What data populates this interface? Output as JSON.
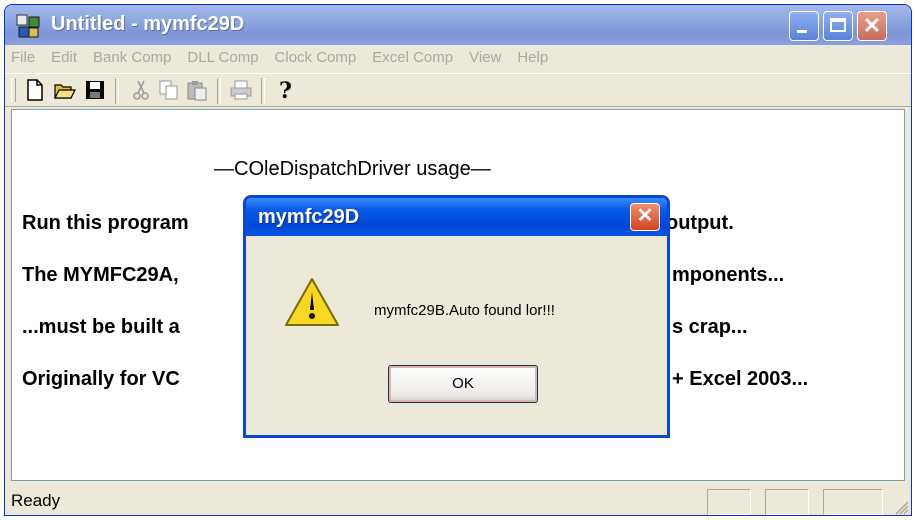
{
  "window": {
    "title": "Untitled - mymfc29D"
  },
  "menu": [
    "File",
    "Edit",
    "Bank Comp",
    "DLL Comp",
    "Clock Comp",
    "Excel Comp",
    "View",
    "Help"
  ],
  "toolbar": [
    "new-icon",
    "open-icon",
    "save-icon",
    "cut-icon",
    "copy-icon",
    "paste-icon",
    "print-icon",
    "help-icon"
  ],
  "content": {
    "heading": "—COleDispatchDriver usage—",
    "line1_left": "Run this program",
    "line1_right": "output.",
    "line2_left": "The MYMFC29A,",
    "line2_right": "mponents...",
    "line3_left": "...must be built a",
    "line3_right": "s crap...",
    "line4_left": "Originally for VC",
    "line4_right": "+ Excel 2003..."
  },
  "status": {
    "text": "Ready"
  },
  "dialog": {
    "title": "mymfc29D",
    "message": "mymfc29B.Auto found lor!!!",
    "ok_label": "OK"
  },
  "colors": {
    "title_active": "#0a55e4",
    "title_inactive": "#8ea6e0",
    "close_red": "#d24420"
  }
}
